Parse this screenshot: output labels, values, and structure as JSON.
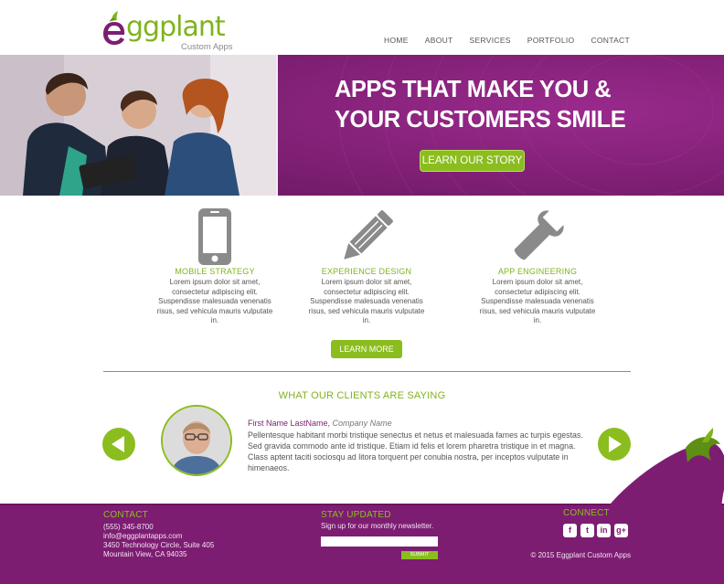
{
  "brand": {
    "name": "ggplant",
    "tagline": "Custom Apps",
    "primary_color": "#7d1d72",
    "accent_color": "#8bbd1f"
  },
  "nav": {
    "items": [
      "HOME",
      "ABOUT",
      "SERVICES",
      "PORTFOLIO",
      "CONTACT"
    ]
  },
  "hero": {
    "title_line1": "APPS THAT MAKE YOU &",
    "title_line2": "YOUR CUSTOMERS SMILE",
    "button": "LEARN OUR STORY"
  },
  "services": [
    {
      "icon": "smartphone-icon",
      "title": "MOBILE STRATEGY",
      "body": "Lorem ipsum dolor sit amet, consectetur adipiscing elit. Suspendisse malesuada venenatis risus, sed vehicula mauris vulputate in."
    },
    {
      "icon": "pencil-icon",
      "title": "EXPERIENCE DESIGN",
      "body": "Lorem ipsum dolor sit amet, consectetur adipiscing elit. Suspendisse malesuada venenatis risus, sed vehicula mauris vulputate in."
    },
    {
      "icon": "wrench-icon",
      "title": "APP ENGINEERING",
      "body": "Lorem ipsum dolor sit amet, consectetur adipiscing elit. Suspendisse malesuada venenatis risus, sed vehicula mauris vulputate in."
    }
  ],
  "learn_more": "LEARN MORE",
  "testimonials": {
    "heading": "WHAT OUR CLIENTS ARE SAYING",
    "name": "First Name LastName,",
    "company": "Company Name",
    "body": "Pellentesque habitant morbi tristique senectus et netus et malesuada fames ac turpis egestas. Sed gravida commodo ante id tristique. Etiam id felis et lorem pharetra tristique in et magna. Class aptent taciti sociosqu ad litora torquent per conubia nostra, per inceptos vulputate in himenaeos."
  },
  "footer": {
    "contact_heading": "CONTACT",
    "phone": "(555) 345-8700",
    "email": "info@eggplantapps.com",
    "address1": "3450 Technology Circle, Suite 405",
    "address2": "Mountain View, CA 94035",
    "stay_heading": "STAY UPDATED",
    "stay_text": "Sign up for our monthly newsletter.",
    "submit": "SUBMIT",
    "connect_heading": "CONNECT",
    "social": [
      {
        "icon": "facebook-icon",
        "glyph": "f"
      },
      {
        "icon": "twitter-icon",
        "glyph": "t"
      },
      {
        "icon": "linkedin-icon",
        "glyph": "in"
      },
      {
        "icon": "google-plus-icon",
        "glyph": "g+"
      }
    ],
    "copyright": "© 2015 Eggplant Custom Apps"
  }
}
